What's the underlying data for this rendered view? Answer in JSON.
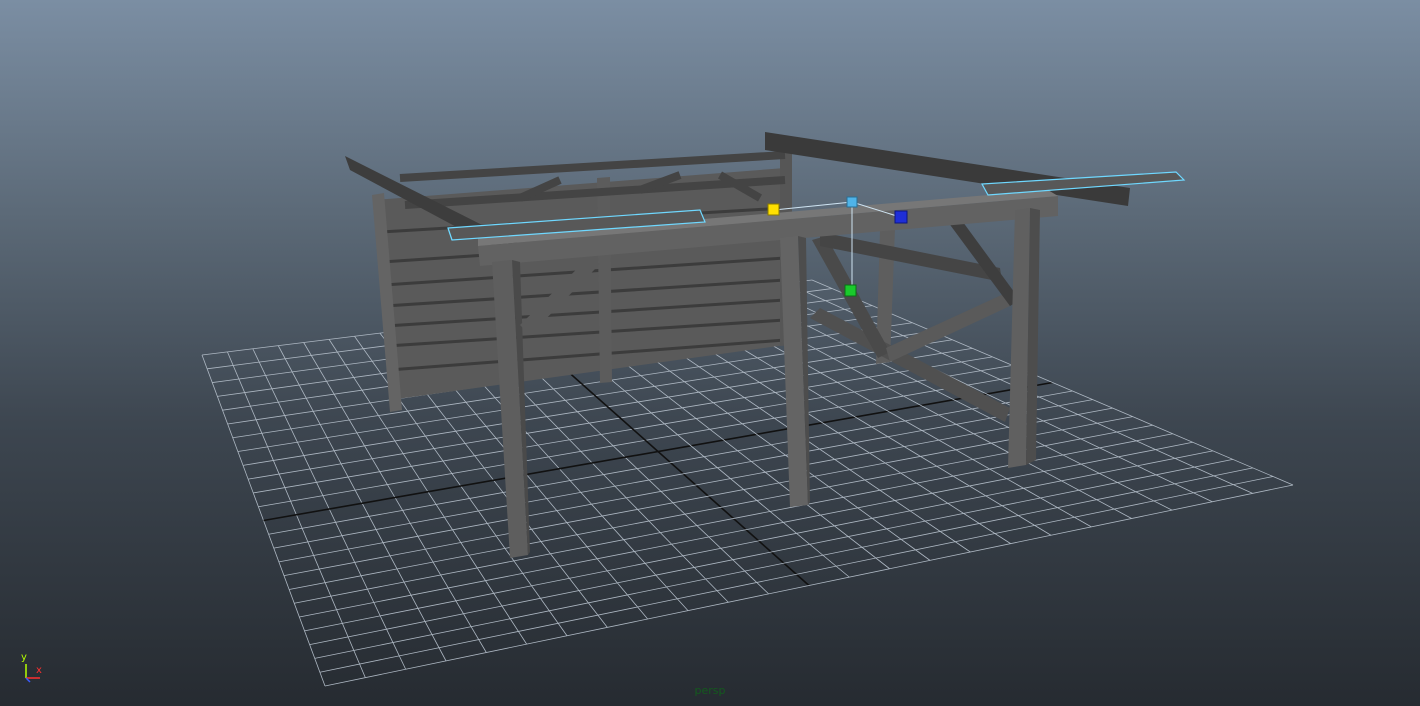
{
  "viewport": {
    "camera_label": "persp",
    "axis_labels": {
      "y": "y",
      "x": "x"
    }
  },
  "colors": {
    "grid_line": "#aeb8c3",
    "grid_axis": "#111111",
    "beam_dark": "#3a3a3a",
    "beam_mid": "#555555",
    "beam_light": "#6e6e6e",
    "selection": "#6fd8ff",
    "handle_yellow": "#ffe000",
    "handle_cyan": "#4fb3e8",
    "handle_blue": "#1e2ed8",
    "handle_green": "#1aca2c"
  },
  "icons": {
    "axis_gizmo": "xyz-axis-gizmo-icon"
  }
}
